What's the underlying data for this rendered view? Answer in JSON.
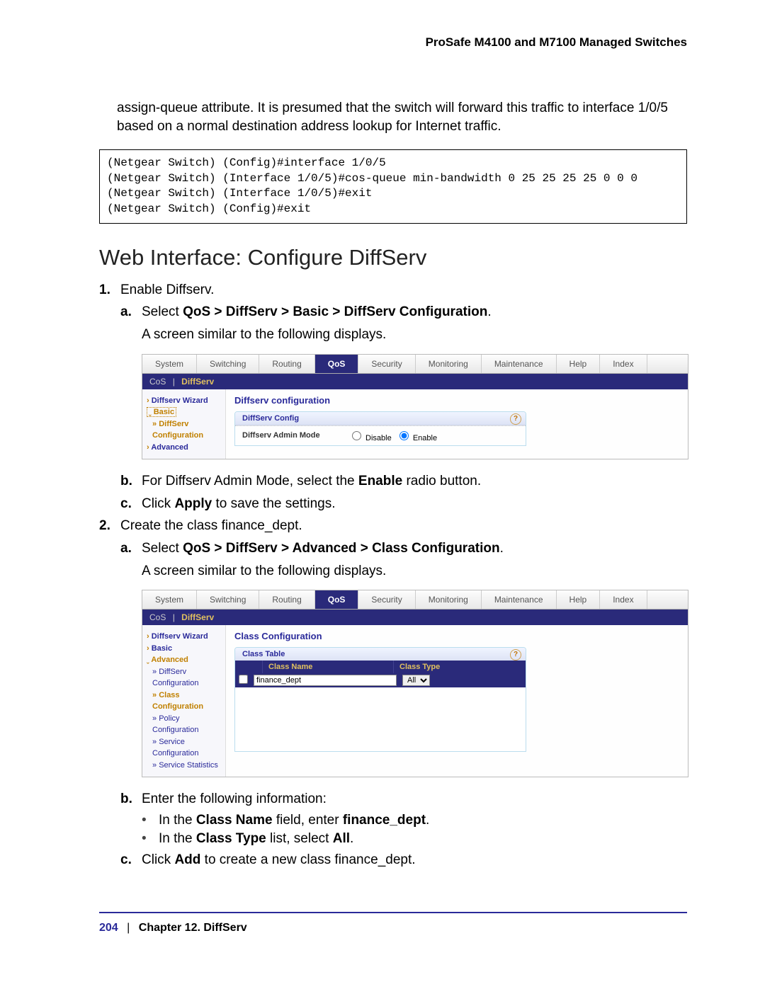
{
  "doc_header": "ProSafe M4100 and M7100 Managed Switches",
  "intro_paragraph": "assign-queue attribute. It is presumed that the switch will forward this traffic to interface 1/0/5 based on a normal destination address lookup for Internet traffic.",
  "code_block": "(Netgear Switch) (Config)#interface 1/0/5\n(Netgear Switch) (Interface 1/0/5)#cos-queue min-bandwidth 0 25 25 25 25 0 0 0\n(Netgear Switch) (Interface 1/0/5)#exit\n(Netgear Switch) (Config)#exit",
  "section_title": "Web Interface: Configure DiffServ",
  "steps": {
    "s1": {
      "num": "1.",
      "text": "Enable Diffserv.",
      "a": {
        "lbl": "a.",
        "prefix": "Select ",
        "bold": "QoS > DiffServ > Basic > DiffServ Configuration",
        "suffix": "."
      },
      "a_after": "A screen similar to the following displays.",
      "b": {
        "lbl": "b.",
        "prefix": "For Diffserv Admin Mode, select the ",
        "bold": "Enable",
        "suffix": " radio button."
      },
      "c": {
        "lbl": "c.",
        "prefix": "Click ",
        "bold": "Apply",
        "suffix": " to save the settings."
      }
    },
    "s2": {
      "num": "2.",
      "text": "Create the class finance_dept.",
      "a": {
        "lbl": "a.",
        "prefix": "Select ",
        "bold": "QoS > DiffServ > Advanced > Class Configuration",
        "suffix": "."
      },
      "a_after": "A screen similar to the following displays.",
      "b": {
        "lbl": "b.",
        "text": "Enter the following information:"
      },
      "bullets": {
        "i1": {
          "pre": "In the ",
          "b1": "Class Name",
          "mid": " field, enter ",
          "b2": "finance_dept",
          "post": "."
        },
        "i2": {
          "pre": "In the ",
          "b1": "Class Type",
          "mid": " list, select ",
          "b2": "All",
          "post": "."
        }
      },
      "c": {
        "lbl": "c.",
        "prefix": "Click ",
        "bold": "Add",
        "suffix": " to create a new class finance_dept."
      }
    }
  },
  "shot1": {
    "tabs": [
      "System",
      "Switching",
      "Routing",
      "QoS",
      "Security",
      "Monitoring",
      "Maintenance",
      "Help",
      "Index"
    ],
    "active_tab": "QoS",
    "subnav_inactive": "CoS",
    "subnav_sep": "|",
    "subnav_active": "DiffServ",
    "side": {
      "wizard": "Diffserv Wizard",
      "basic": "Basic",
      "diffserv_cfg": "DiffServ Configuration",
      "advanced": "Advanced"
    },
    "panel_title": "Diffserv configuration",
    "box_head": "DiffServ Config",
    "row_label": "Diffserv Admin Mode",
    "opt_disable": "Disable",
    "opt_enable": "Enable"
  },
  "shot2": {
    "tabs": [
      "System",
      "Switching",
      "Routing",
      "QoS",
      "Security",
      "Monitoring",
      "Maintenance",
      "Help",
      "Index"
    ],
    "active_tab": "QoS",
    "subnav_inactive": "CoS",
    "subnav_sep": "|",
    "subnav_active": "DiffServ",
    "side": {
      "wizard": "Diffserv Wizard",
      "basic": "Basic",
      "advanced": "Advanced",
      "items": {
        "diffserv": "DiffServ Configuration",
        "classcfg": "Class Configuration",
        "policy": "Policy Configuration",
        "service": "Service Configuration",
        "stats": "Service Statistics"
      }
    },
    "panel_title": "Class Configuration",
    "table_head": "Class Table",
    "col_name": "Class Name",
    "col_type": "Class Type",
    "row_name_value": "finance_dept",
    "row_type_value": "All"
  },
  "footer": {
    "page": "204",
    "sep": "|",
    "chapter": "Chapter 12.  DiffServ"
  }
}
